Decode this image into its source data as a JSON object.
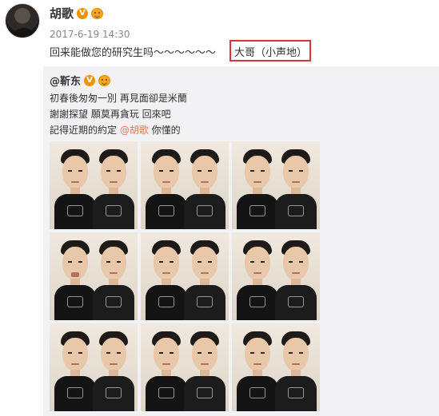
{
  "post": {
    "author": "胡歌",
    "verified_badge": "V",
    "timestamp": "2017-6-19 14:30",
    "text": "回来能做您的研究生吗～～～～～～",
    "highlighted_text": "大哥（小声地）"
  },
  "repost": {
    "author_prefix": "@",
    "author": "靳东",
    "verified_badge": "V",
    "line1": "初春後匆匆一別 再見面卻是米蘭",
    "line2": "謝謝探望 願莫再貪玩 回來吧",
    "line3_prefix": "記得近期的約定 ",
    "line3_mention": "@胡歌",
    "line3_suffix": " 你懂的",
    "photo_count": 9
  },
  "colors": {
    "highlight_border": "#d8343a",
    "mention": "#eb7350",
    "repost_bg": "#f2f2f5",
    "verified_badge": "#f29100"
  },
  "icons": {
    "verified": "verified-v-icon",
    "member_emoji": "member-smile-icon"
  }
}
